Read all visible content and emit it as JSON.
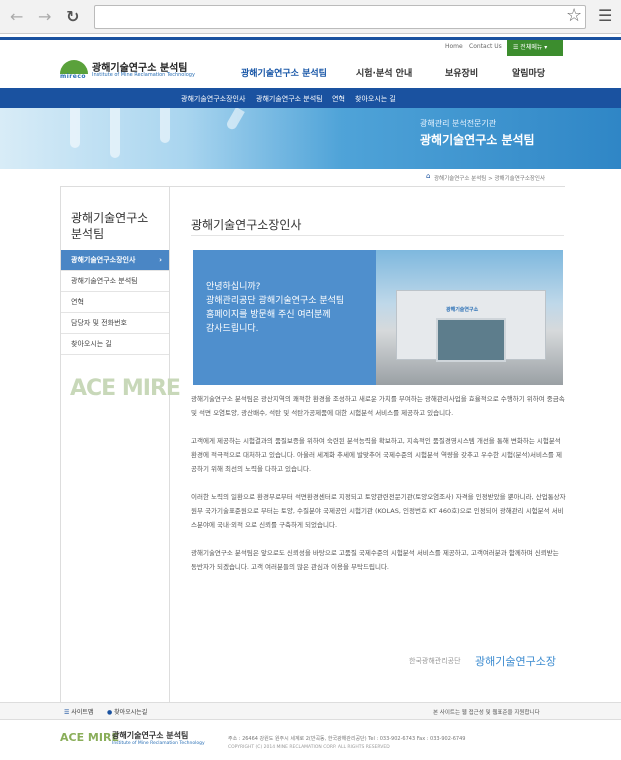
{
  "browser": {
    "back_icon": "arrow-left-icon",
    "forward_icon": "arrow-right-icon",
    "reload_icon": "reload-icon",
    "url": "",
    "star_icon": "star-icon",
    "menu_icon": "hamburger-icon"
  },
  "util": {
    "home": "Home",
    "contact": "Contact Us",
    "all_menu": "전체메뉴"
  },
  "logo": {
    "mark_text": "mireco",
    "title": "광해기술연구소 분석팀",
    "subtitle": "Institute of Mine Reclamation Technology"
  },
  "gnb": [
    "광해기술연구소 분석팀",
    "시험·분석 안내",
    "보유장비",
    "알림마당"
  ],
  "lnb": [
    "광해기술연구소장인사",
    "광해기술연구소 분석팀",
    "연혁",
    "찾아오시는 길"
  ],
  "banner": {
    "sub": "광해관리 분석전문기관",
    "title": "광해기술연구소 분석팀"
  },
  "breadcrumb": "광해기술연구소 분석팀 > 광해기술연구소장인사",
  "sidebar": {
    "title_line1": "광해기술연구소",
    "title_line2": "분석팀",
    "items": [
      "광해기술연구소장인사",
      "광해기술연구소 분석팀",
      "연혁",
      "담당자 및 전화번호",
      "찾아오시는 길"
    ],
    "badge": "ACE MIRE"
  },
  "content": {
    "title": "광해기술연구소장인사",
    "greeting": "안녕하십니까?\n광해관리공단 광해기술연구소 분석팀\n홈페이지를 방문해 주신 여러분께\n감사드립니다.",
    "photo_sign": "광해기술연구소",
    "paragraphs": [
      "광해기술연구소 분석팀은 광산지역의 쾌적한 환경을 조성하고 새로운 가치를 부여하는 광해관리사업을 효율적으로 수행하기 위하여 중금속 및 석면 오염토양, 광산배수, 석탄 및 석탄가공제품에 대한 시험분석 서비스를 제공하고 있습니다.",
      "고객에게 제공하는 시험결과의 품질보증을 위하여 숙련된 분석능력을 확보하고, 지속적인 품질경영시스템 개선을 통해 변화하는 시험분석 환경에 적극적으로 대처하고 있습니다. 아울러 세계화 추세에 발맞추어 국제수준의 시험분석 역량을 갖추고 우수한 시험(분석)서비스를 제공하기 위해 최선의 노력을 다하고 있습니다.",
      "이러한 노력의 일환으로 환경부로부터 석면환경센터로 지정되고 토양관련전문기관(토양오염조사) 자격을 인정받았을 뿐아니라, 산업통상자원부 국가기술표준원으로 부터는 토양, 수질분야 국제공인 시험기관 (KOLAS, 인정번호 KT 460호)으로 인정되어 광해관리 시험분석 서비스분야에 국내·외적 으로 신뢰를 구축하게 되었습니다.",
      "광해기술연구소 분석팀은 앞으로도 신뢰성을 바탕으로 고품질 국제수준의 시험분석 서비스를 제공하고, 고객여러분과 함께하며 신뢰받는 동반자가 되겠습니다. 고객 여러분들의 많은 관심과 이용을 부탁드립니다."
    ],
    "sign_org": "한국광해관리공단",
    "sign_name": "광해기술연구소장"
  },
  "footer": {
    "sitemap": "사이트맵",
    "directions": "찾아오시는길",
    "notice": "본 사이트는 웹 접근성 및 웹표준을 지원합니다",
    "logo_ace": "ACE MIRE",
    "logo_title": "광해기술연구소 분석팀",
    "logo_sub": "Institute of Mine Reclamation Technology",
    "address": "주소 : 26464 강원도 원주시 세계로 2(반곡동, 한국광해관리공단)   Tel : 033-902-6743   Fax : 033-902-6749",
    "copyright": "COPYRIGHT (C) 2014 MINE RECLAMATION CORP. ALL RIGHTS RESERVED"
  }
}
